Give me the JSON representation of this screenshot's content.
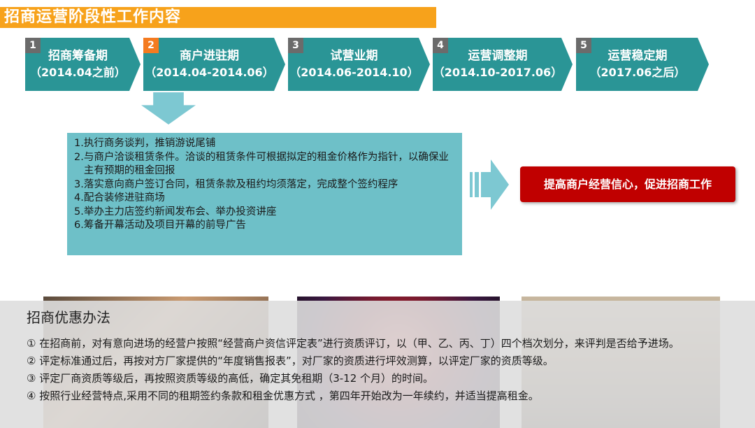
{
  "title": "招商运营阶段性工作内容",
  "phases": [
    {
      "num": "1",
      "name": "招商筹备期",
      "range": "（2014.04之前）"
    },
    {
      "num": "2",
      "name": "商户进驻期",
      "range": "（2014.04-2014.06）"
    },
    {
      "num": "3",
      "name": "试营业期",
      "range": "（2014.06-2014.10）"
    },
    {
      "num": "4",
      "name": "运营调整期",
      "range": "（2014.10-2017.06）"
    },
    {
      "num": "5",
      "name": "运营稳定期",
      "range": "（2017.06之后）"
    }
  ],
  "tasks": [
    {
      "idx": "1. ",
      "text": "执行商务谈判，推销游说尾铺"
    },
    {
      "idx": "2. ",
      "text": "与商户洽谈租赁条件。洽谈的租赁条件可根据拟定的租金价格作为指针，以确保业主有预期的租金回报"
    },
    {
      "idx": "3. ",
      "text": "落实意向商户签订合同，租赁条款及租约均须落定，完成整个签约程序"
    },
    {
      "idx": "4. ",
      "text": "配合装修进驻商场"
    },
    {
      "idx": "5. ",
      "text": "举办主力店签约新闻发布会、举办投资讲座"
    },
    {
      "idx": "6. ",
      "text": "筹备开幕活动及项目开幕的前导广告"
    }
  ],
  "result": "提高商户经营信心，促进招商工作",
  "policy": {
    "title": "招商优惠办法",
    "items": [
      "① 在招商前，对有意向进场的经营户按照“经营商户资信评定表”进行资质评订，以（甲、乙、丙、丁）四个档次划分，来评判是否给予进场。",
      "② 评定标准通过后，再按对方厂家提供的“年度销售报表”，对厂家的资质进行坪效测算，以评定厂家的资质等级。",
      "③ 评定厂商资质等级后，再按照资质等级的高低，确定其免租期（3-12 个月）的时间。",
      "④ 按照行业经营特点,采用不同的租期签约条款和租金优惠方式 ，第四年开始改为一年续约，并适当提高租金。"
    ]
  },
  "colors": {
    "title_bar": "#f7a21b",
    "phase": "#2a9596",
    "current_badge": "#f47b20",
    "task_box": "#6ec0c8",
    "result_box": "#c00000"
  }
}
